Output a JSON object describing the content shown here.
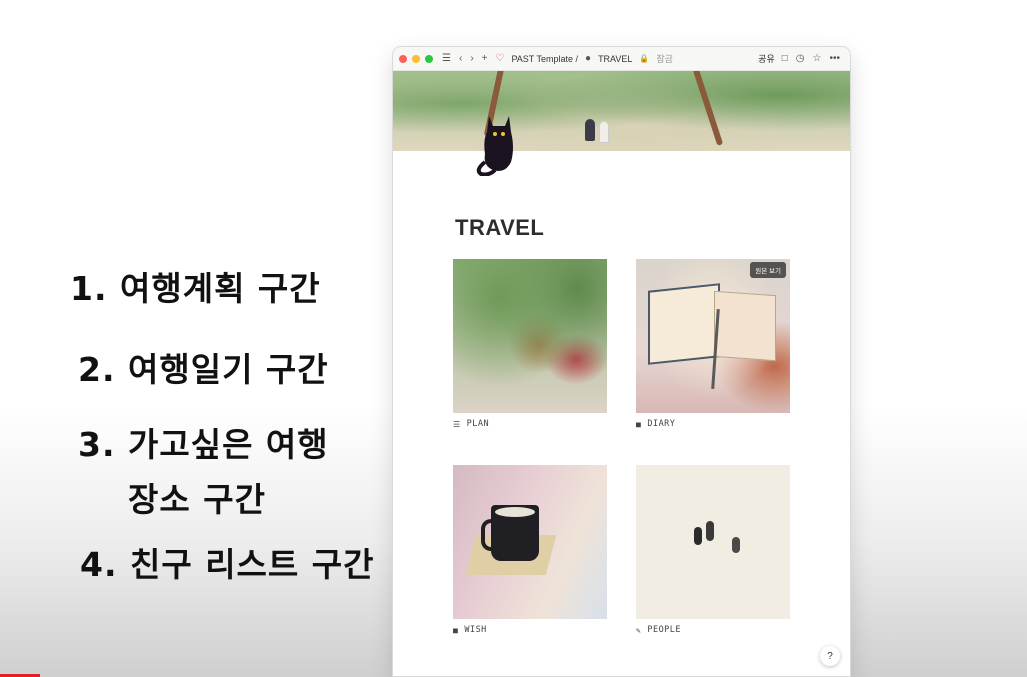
{
  "notes": {
    "line1": "1. 여행계획 구간",
    "line2": "2. 여행일기 구간",
    "line3a": "3. 가고싶은 여행",
    "line3b": "장소 구간",
    "line4": "4. 친구 리스트 구간"
  },
  "window": {
    "breadcrumb": {
      "workspace": "PAST Template /",
      "page": "TRAVEL",
      "lock": "잠금"
    },
    "actions": {
      "share": "공유"
    }
  },
  "page": {
    "title": "TRAVEL",
    "cards": [
      {
        "label": "PLAN",
        "icon": "notepad-icon"
      },
      {
        "label": "DIARY",
        "icon": "book-icon",
        "badge": "원본 보기"
      },
      {
        "label": "WISH",
        "icon": "box-icon"
      },
      {
        "label": "PEOPLE",
        "icon": "pencil-icon"
      }
    ],
    "help": "?"
  },
  "colors": {
    "close": "#ff5f57",
    "minimize": "#febc2e",
    "maximize": "#28c840",
    "heart": "#e0424b",
    "video_progress": "#e02020"
  }
}
